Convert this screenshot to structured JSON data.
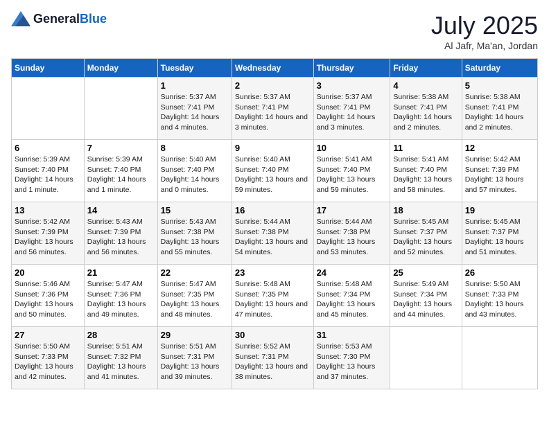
{
  "header": {
    "logo_general": "General",
    "logo_blue": "Blue",
    "month": "July 2025",
    "location": "Al Jafr, Ma'an, Jordan"
  },
  "weekdays": [
    "Sunday",
    "Monday",
    "Tuesday",
    "Wednesday",
    "Thursday",
    "Friday",
    "Saturday"
  ],
  "weeks": [
    [
      {
        "day": "",
        "info": ""
      },
      {
        "day": "",
        "info": ""
      },
      {
        "day": "1",
        "info": "Sunrise: 5:37 AM\nSunset: 7:41 PM\nDaylight: 14 hours and 4 minutes."
      },
      {
        "day": "2",
        "info": "Sunrise: 5:37 AM\nSunset: 7:41 PM\nDaylight: 14 hours and 3 minutes."
      },
      {
        "day": "3",
        "info": "Sunrise: 5:37 AM\nSunset: 7:41 PM\nDaylight: 14 hours and 3 minutes."
      },
      {
        "day": "4",
        "info": "Sunrise: 5:38 AM\nSunset: 7:41 PM\nDaylight: 14 hours and 2 minutes."
      },
      {
        "day": "5",
        "info": "Sunrise: 5:38 AM\nSunset: 7:41 PM\nDaylight: 14 hours and 2 minutes."
      }
    ],
    [
      {
        "day": "6",
        "info": "Sunrise: 5:39 AM\nSunset: 7:40 PM\nDaylight: 14 hours and 1 minute."
      },
      {
        "day": "7",
        "info": "Sunrise: 5:39 AM\nSunset: 7:40 PM\nDaylight: 14 hours and 1 minute."
      },
      {
        "day": "8",
        "info": "Sunrise: 5:40 AM\nSunset: 7:40 PM\nDaylight: 14 hours and 0 minutes."
      },
      {
        "day": "9",
        "info": "Sunrise: 5:40 AM\nSunset: 7:40 PM\nDaylight: 13 hours and 59 minutes."
      },
      {
        "day": "10",
        "info": "Sunrise: 5:41 AM\nSunset: 7:40 PM\nDaylight: 13 hours and 59 minutes."
      },
      {
        "day": "11",
        "info": "Sunrise: 5:41 AM\nSunset: 7:40 PM\nDaylight: 13 hours and 58 minutes."
      },
      {
        "day": "12",
        "info": "Sunrise: 5:42 AM\nSunset: 7:39 PM\nDaylight: 13 hours and 57 minutes."
      }
    ],
    [
      {
        "day": "13",
        "info": "Sunrise: 5:42 AM\nSunset: 7:39 PM\nDaylight: 13 hours and 56 minutes."
      },
      {
        "day": "14",
        "info": "Sunrise: 5:43 AM\nSunset: 7:39 PM\nDaylight: 13 hours and 56 minutes."
      },
      {
        "day": "15",
        "info": "Sunrise: 5:43 AM\nSunset: 7:38 PM\nDaylight: 13 hours and 55 minutes."
      },
      {
        "day": "16",
        "info": "Sunrise: 5:44 AM\nSunset: 7:38 PM\nDaylight: 13 hours and 54 minutes."
      },
      {
        "day": "17",
        "info": "Sunrise: 5:44 AM\nSunset: 7:38 PM\nDaylight: 13 hours and 53 minutes."
      },
      {
        "day": "18",
        "info": "Sunrise: 5:45 AM\nSunset: 7:37 PM\nDaylight: 13 hours and 52 minutes."
      },
      {
        "day": "19",
        "info": "Sunrise: 5:45 AM\nSunset: 7:37 PM\nDaylight: 13 hours and 51 minutes."
      }
    ],
    [
      {
        "day": "20",
        "info": "Sunrise: 5:46 AM\nSunset: 7:36 PM\nDaylight: 13 hours and 50 minutes."
      },
      {
        "day": "21",
        "info": "Sunrise: 5:47 AM\nSunset: 7:36 PM\nDaylight: 13 hours and 49 minutes."
      },
      {
        "day": "22",
        "info": "Sunrise: 5:47 AM\nSunset: 7:35 PM\nDaylight: 13 hours and 48 minutes."
      },
      {
        "day": "23",
        "info": "Sunrise: 5:48 AM\nSunset: 7:35 PM\nDaylight: 13 hours and 47 minutes."
      },
      {
        "day": "24",
        "info": "Sunrise: 5:48 AM\nSunset: 7:34 PM\nDaylight: 13 hours and 45 minutes."
      },
      {
        "day": "25",
        "info": "Sunrise: 5:49 AM\nSunset: 7:34 PM\nDaylight: 13 hours and 44 minutes."
      },
      {
        "day": "26",
        "info": "Sunrise: 5:50 AM\nSunset: 7:33 PM\nDaylight: 13 hours and 43 minutes."
      }
    ],
    [
      {
        "day": "27",
        "info": "Sunrise: 5:50 AM\nSunset: 7:33 PM\nDaylight: 13 hours and 42 minutes."
      },
      {
        "day": "28",
        "info": "Sunrise: 5:51 AM\nSunset: 7:32 PM\nDaylight: 13 hours and 41 minutes."
      },
      {
        "day": "29",
        "info": "Sunrise: 5:51 AM\nSunset: 7:31 PM\nDaylight: 13 hours and 39 minutes."
      },
      {
        "day": "30",
        "info": "Sunrise: 5:52 AM\nSunset: 7:31 PM\nDaylight: 13 hours and 38 minutes."
      },
      {
        "day": "31",
        "info": "Sunrise: 5:53 AM\nSunset: 7:30 PM\nDaylight: 13 hours and 37 minutes."
      },
      {
        "day": "",
        "info": ""
      },
      {
        "day": "",
        "info": ""
      }
    ]
  ]
}
